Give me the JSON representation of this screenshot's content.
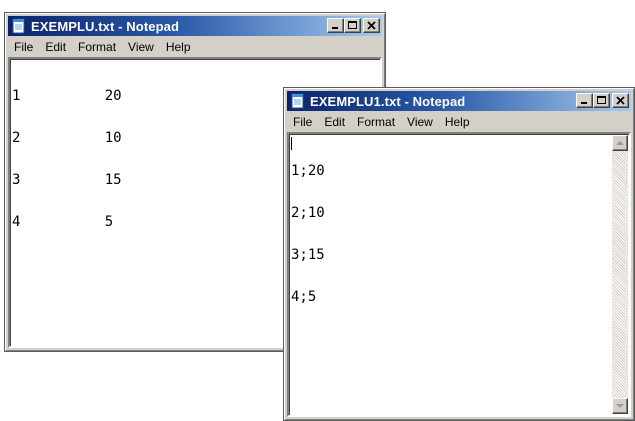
{
  "windows": [
    {
      "title": "EXEMPLU.txt - Notepad",
      "menu": [
        "File",
        "Edit",
        "Format",
        "View",
        "Help"
      ],
      "lines": [
        "1          20",
        "2          10",
        "3          15",
        "4          5"
      ]
    },
    {
      "title": "EXEMPLU1.txt - Notepad",
      "menu": [
        "File",
        "Edit",
        "Format",
        "View",
        "Help"
      ],
      "lines": [
        "1;20",
        "2;10",
        "3;15",
        "4;5"
      ]
    }
  ],
  "icons": {
    "app": "notepad-icon",
    "minimize": "minimize-icon",
    "maximize": "maximize-icon",
    "close": "close-icon",
    "scroll_up": "scroll-up-arrow-icon",
    "scroll_down": "scroll-down-arrow-icon"
  },
  "colors": {
    "titlebar_start": "#0a246a",
    "titlebar_end": "#a6caf0",
    "window_face": "#d4d0c8"
  }
}
